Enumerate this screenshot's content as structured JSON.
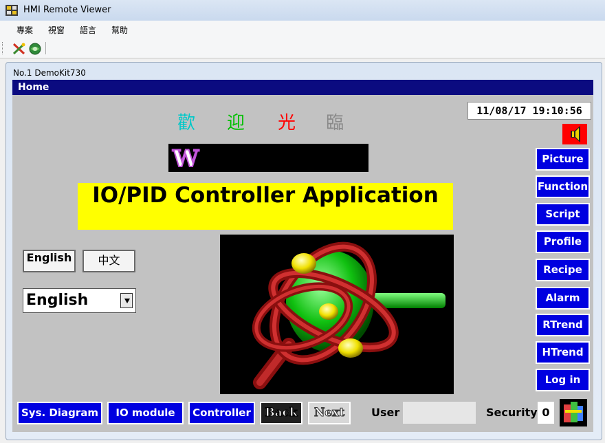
{
  "window": {
    "title": "HMI Remote Viewer"
  },
  "menu": [
    "專案",
    "視窗",
    "語言",
    "幫助"
  ],
  "toolbar": {
    "icons": [
      "tools-icon",
      "globe-icon"
    ]
  },
  "inner_window": {
    "title": "No.1 DemoKit730"
  },
  "screen": {
    "header": "Home",
    "welcome": [
      {
        "char": "歡",
        "color": "#00c8c8"
      },
      {
        "char": "迎",
        "color": "#00c000"
      },
      {
        "char": "光",
        "color": "#ff0000"
      },
      {
        "char": "臨",
        "color": "#8a8a8a"
      }
    ],
    "datetime": "11/08/17 19:10:56",
    "banner_letter": "W",
    "app_title": "IO/PID Controller Application",
    "language_buttons": [
      "English",
      "中文"
    ],
    "language_select": {
      "value": "English"
    },
    "side_buttons": [
      "Picture",
      "Function",
      "Script",
      "Profile",
      "Recipe",
      "Alarm",
      "RTrend",
      "HTrend",
      "Log in"
    ],
    "bottom_buttons": [
      "Sys. Diagram",
      "IO module",
      "Controller"
    ],
    "nav": {
      "back": "Back",
      "next": "Next"
    },
    "user": {
      "label": "User",
      "value": ""
    },
    "security": {
      "label": "Security",
      "value": "0"
    }
  },
  "colors": {
    "header_bg": "#0b0b80",
    "panel_bg": "#c2c2c2",
    "button_blue": "#0000e0",
    "title_yellow": "#ffff00"
  }
}
